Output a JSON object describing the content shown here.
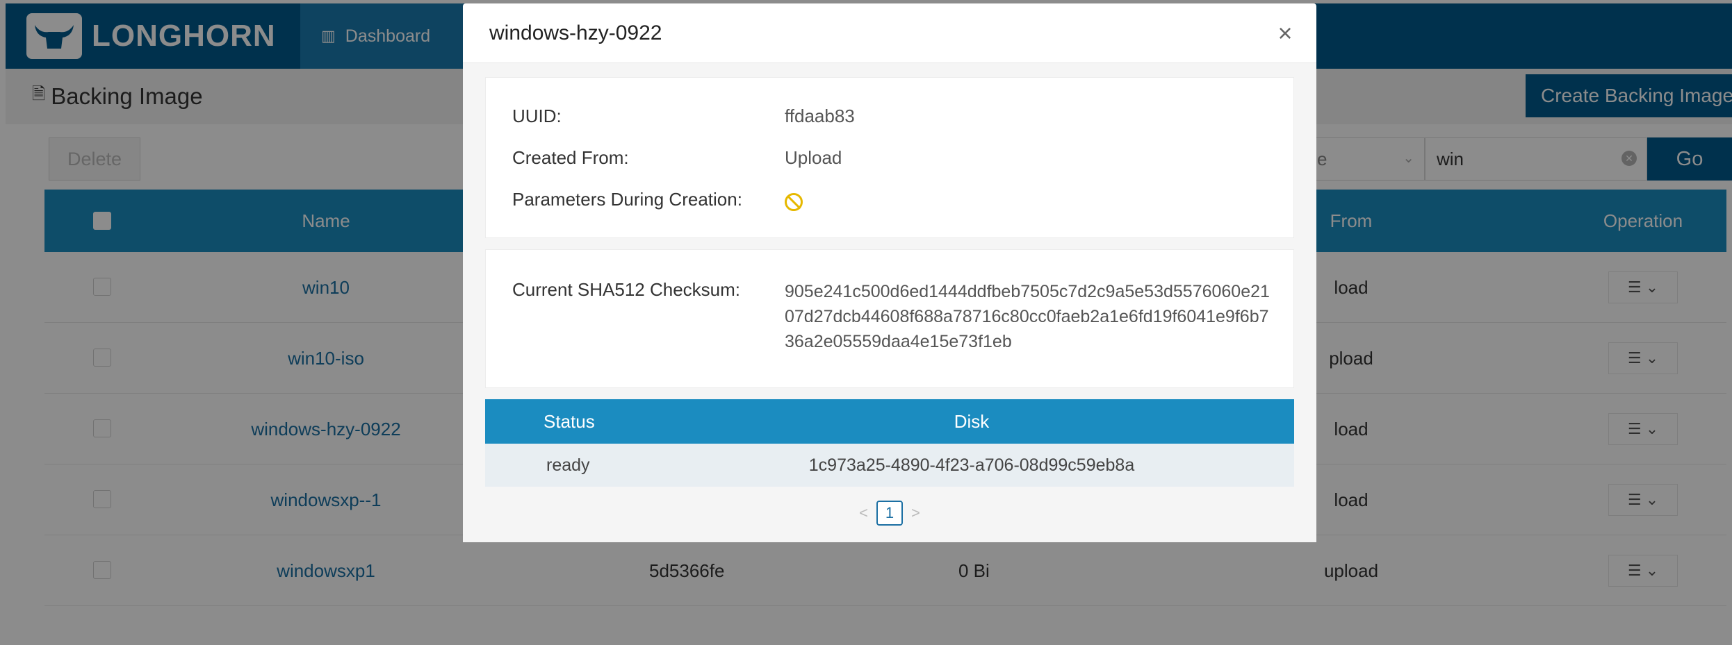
{
  "app": {
    "brand": "LONGHORN",
    "nav": {
      "dashboard_label": "Dashboard"
    }
  },
  "page": {
    "title": "Backing Image",
    "create_label": "Create Backing Image",
    "delete_label": "Delete",
    "filter_value": "e",
    "search_value": "win",
    "go_label": "Go"
  },
  "table": {
    "headers": {
      "name": "Name",
      "from": "From",
      "operation": "Operation"
    },
    "rows": [
      {
        "name": "win10",
        "uuid": "",
        "size": "",
        "from": "load"
      },
      {
        "name": "win10-iso",
        "uuid": "",
        "size": "",
        "from": "pload"
      },
      {
        "name": "windows-hzy-0922",
        "uuid": "",
        "size": "",
        "from": "load"
      },
      {
        "name": "windowsxp--1",
        "uuid": "",
        "size": "",
        "from": "load"
      },
      {
        "name": "windowsxp1",
        "uuid": "5d5366fe",
        "size": "0 Bi",
        "from": "upload"
      }
    ]
  },
  "modal": {
    "title": "windows-hzy-0922",
    "uuid_label": "UUID:",
    "uuid_value": "ffdaab83",
    "created_from_label": "Created From:",
    "created_from_value": "Upload",
    "params_label": "Parameters During Creation:",
    "checksum_label": "Current SHA512 Checksum:",
    "checksum_value": "905e241c500d6ed1444ddfbeb7505c7d2c9a5e53d5576060e2107d27dcb44608f688a78716c80cc0faeb2a1e6fd19f6041e9f6b736a2e05559daa4e15e73f1eb",
    "disk_table": {
      "headers": {
        "status": "Status",
        "disk": "Disk"
      },
      "rows": [
        {
          "status": "ready",
          "disk": "1c973a25-4890-4f23-a706-08d99c59eb8a"
        }
      ]
    },
    "pagination": {
      "current_page": "1"
    }
  }
}
